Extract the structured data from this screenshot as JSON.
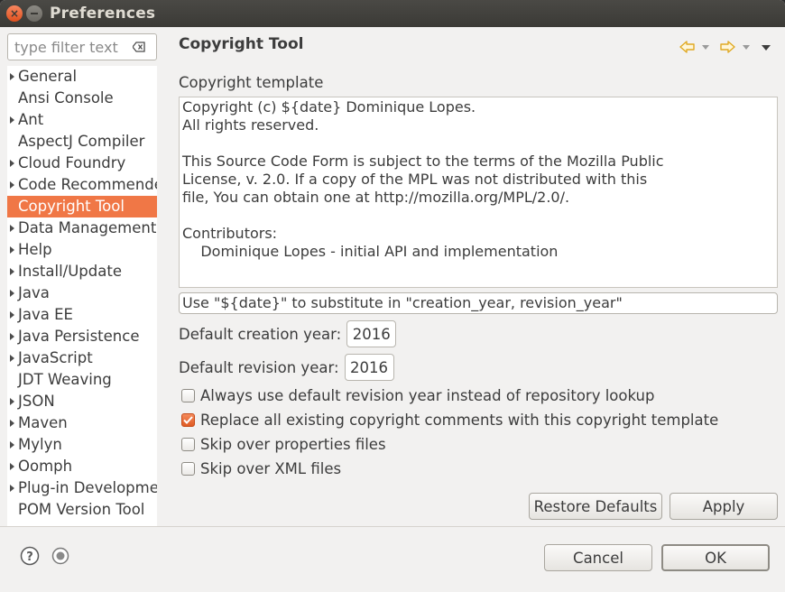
{
  "window": {
    "title": "Preferences"
  },
  "filter": {
    "placeholder": "type filter text"
  },
  "tree": {
    "items": [
      {
        "label": "General",
        "expandable": true
      },
      {
        "label": "Ansi Console",
        "expandable": false
      },
      {
        "label": "Ant",
        "expandable": true
      },
      {
        "label": "AspectJ Compiler",
        "expandable": false
      },
      {
        "label": "Cloud Foundry",
        "expandable": true
      },
      {
        "label": "Code Recommenders",
        "expandable": true
      },
      {
        "label": "Copyright Tool",
        "expandable": false,
        "selected": true
      },
      {
        "label": "Data Management",
        "expandable": true
      },
      {
        "label": "Help",
        "expandable": true
      },
      {
        "label": "Install/Update",
        "expandable": true
      },
      {
        "label": "Java",
        "expandable": true
      },
      {
        "label": "Java EE",
        "expandable": true
      },
      {
        "label": "Java Persistence",
        "expandable": true
      },
      {
        "label": "JavaScript",
        "expandable": true
      },
      {
        "label": "JDT Weaving",
        "expandable": false
      },
      {
        "label": "JSON",
        "expandable": true
      },
      {
        "label": "Maven",
        "expandable": true
      },
      {
        "label": "Mylyn",
        "expandable": true
      },
      {
        "label": "Oomph",
        "expandable": true
      },
      {
        "label": "Plug-in Development",
        "expandable": true
      },
      {
        "label": "POM Version Tool",
        "expandable": false
      }
    ]
  },
  "page": {
    "title": "Copyright Tool",
    "template_label": "Copyright template",
    "template_text": "Copyright (c) ${date} Dominique Lopes.\nAll rights reserved.\n\nThis Source Code Form is subject to the terms of the Mozilla Public\nLicense, v. 2.0. If a copy of the MPL was not distributed with this\nfile, You can obtain one at http://mozilla.org/MPL/2.0/.\n\nContributors:\n    Dominique Lopes - initial API and implementation",
    "hint": "Use \"${date}\" to substitute in \"creation_year, revision_year\"",
    "creation_label": "Default creation year:",
    "creation_year": "2016",
    "revision_label": "Default revision year:",
    "revision_year": "2016",
    "options": [
      {
        "label": "Always use default revision year instead of repository lookup",
        "checked": false
      },
      {
        "label": "Replace all existing copyright comments with this copyright template",
        "checked": true
      },
      {
        "label": "Skip over properties files",
        "checked": false
      },
      {
        "label": "Skip over XML files",
        "checked": false
      }
    ],
    "restore_label": "Restore Defaults",
    "apply_label": "Apply"
  },
  "footer": {
    "cancel_label": "Cancel",
    "ok_label": "OK"
  },
  "colors": {
    "accent": "#f07746",
    "titlebar": "#3b3a36",
    "nav_arrow": "#e8b430"
  }
}
